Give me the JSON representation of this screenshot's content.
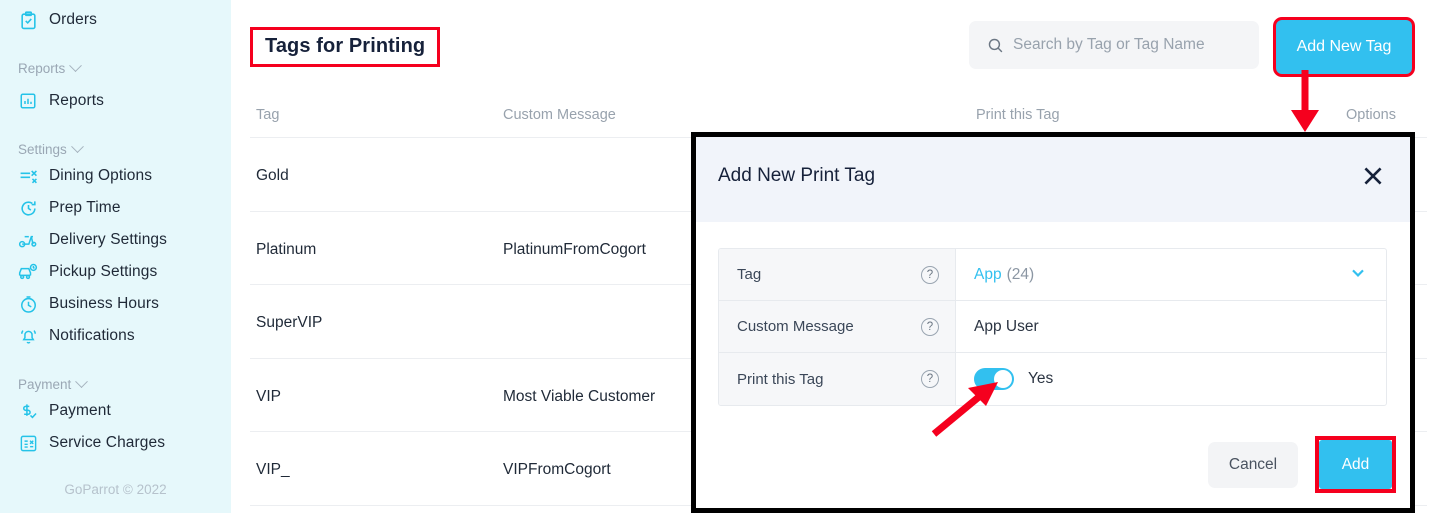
{
  "sidebar": {
    "top_item": {
      "label": "Orders",
      "icon": "clipboard-check-icon"
    },
    "groups": [
      {
        "title": "Reports",
        "items": [
          {
            "label": "Reports",
            "icon": "bar-chart-icon"
          }
        ]
      },
      {
        "title": "Settings",
        "items": [
          {
            "label": "Dining Options",
            "icon": "dining-options-icon"
          },
          {
            "label": "Prep Time",
            "icon": "clock-refresh-icon"
          },
          {
            "label": "Delivery Settings",
            "icon": "scooter-icon"
          },
          {
            "label": "Pickup Settings",
            "icon": "car-clock-icon"
          },
          {
            "label": "Business Hours",
            "icon": "stopwatch-icon"
          },
          {
            "label": "Notifications",
            "icon": "bell-icon"
          }
        ]
      },
      {
        "title": "Payment",
        "items": [
          {
            "label": "Payment",
            "icon": "dollar-check-icon"
          },
          {
            "label": "Service Charges",
            "icon": "receipt-icon"
          }
        ]
      }
    ],
    "footer": "GoParrot © 2022"
  },
  "main": {
    "page_title": "Tags for Printing",
    "search": {
      "placeholder": "Search by Tag or Tag Name",
      "value": "",
      "icon": "search-icon"
    },
    "add_new_tag_label": "Add New Tag",
    "table": {
      "headers": [
        "Tag",
        "Custom Message",
        "Print this Tag",
        "Options"
      ],
      "rows": [
        {
          "tag": "Gold",
          "custom_message": ""
        },
        {
          "tag": "Platinum",
          "custom_message": "PlatinumFromCogort"
        },
        {
          "tag": "SuperVIP",
          "custom_message": ""
        },
        {
          "tag": "VIP",
          "custom_message": "Most Viable Customer"
        },
        {
          "tag": "VIP_",
          "custom_message": "VIPFromCogort"
        }
      ]
    }
  },
  "modal": {
    "title": "Add New Print Tag",
    "close_icon": "close-icon",
    "fields": {
      "tag": {
        "label": "Tag",
        "help_icon": "question-mark-icon",
        "value": "App",
        "count": "(24)",
        "chevron_icon": "chevron-down-icon"
      },
      "custom_message": {
        "label": "Custom Message",
        "help_icon": "question-mark-icon",
        "value": "App User"
      },
      "print_this_tag": {
        "label": "Print this Tag",
        "help_icon": "question-mark-icon",
        "toggle_state": "on",
        "toggle_text": "Yes"
      }
    },
    "cancel_label": "Cancel",
    "add_label": "Add"
  },
  "colors": {
    "accent": "#32c0ef",
    "sidebar_bg": "#e6f8fb",
    "annotation_red": "#f5001e",
    "modal_header_bg": "#f1f4fa"
  }
}
